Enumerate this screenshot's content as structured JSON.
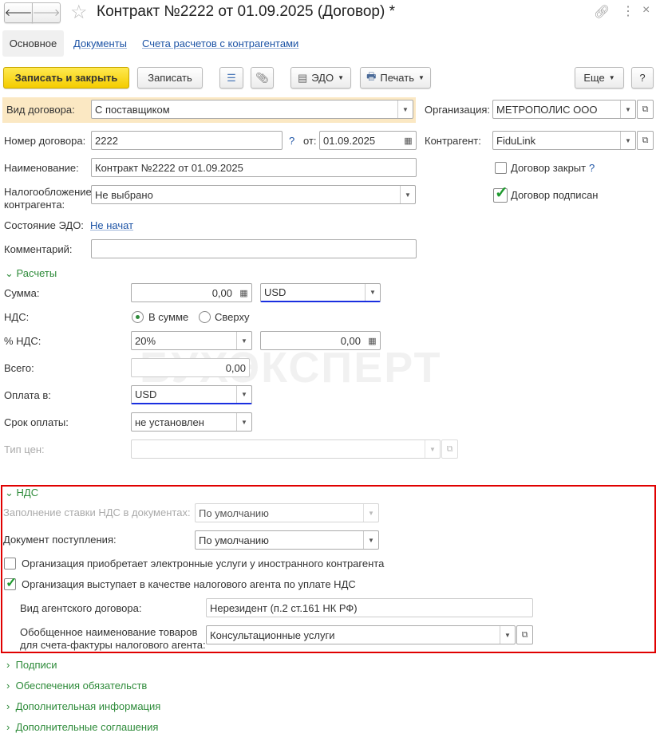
{
  "window": {
    "title": "Контракт №2222 от 01.09.2025 (Договор) *"
  },
  "tabs": [
    {
      "label": "Основное"
    },
    {
      "label": "Документы"
    },
    {
      "label": "Счета расчетов с контрагентами"
    }
  ],
  "toolbar": {
    "save_close": "Записать и закрыть",
    "save": "Записать",
    "edo": "ЭДО",
    "print": "Печать",
    "more": "Еще",
    "help": "?"
  },
  "watermark": "БУХЭКСПЕРТ",
  "main": {
    "contract_type": {
      "label": "Вид договора:",
      "value": "С поставщиком"
    },
    "organization": {
      "label": "Организация:",
      "value": "МЕТРОПОЛИС ООО"
    },
    "number": {
      "label": "Номер договора:",
      "value": "2222",
      "help": "?",
      "date_label": "от:",
      "date": "01.09.2025"
    },
    "counterparty": {
      "label": "Контрагент:",
      "value": "FiduLink"
    },
    "name": {
      "label": "Наименование:",
      "value": "Контракт №2222 от 01.09.2025"
    },
    "closed": {
      "label": "Договор закрыт",
      "help": "?",
      "checked": false
    },
    "taxation": {
      "label1": "Налогообложение",
      "label2": "контрагента:",
      "value": "Не выбрано"
    },
    "signed": {
      "label": "Договор подписан",
      "checked": true
    },
    "edo_state": {
      "label": "Состояние ЭДО:",
      "value": "Не начат"
    },
    "comment": {
      "label": "Комментарий:",
      "value": ""
    }
  },
  "payments": {
    "title": "Расчеты",
    "sum": {
      "label": "Сумма:",
      "value": "0,00",
      "currency": "USD"
    },
    "vat": {
      "label": "НДС:",
      "option1": "В сумме",
      "option2": "Сверху",
      "selected": "В сумме"
    },
    "vat_rate": {
      "label": "% НДС:",
      "value": "20%",
      "amount": "0,00"
    },
    "total": {
      "label": "Всего:",
      "value": "0,00"
    },
    "pay_in": {
      "label": "Оплата в:",
      "value": "USD"
    },
    "term": {
      "label": "Срок оплаты:",
      "value": "не установлен"
    },
    "price_type": {
      "label": "Тип цен:",
      "value": ""
    }
  },
  "vat_section": {
    "title": "НДС",
    "fill_rate": {
      "label": "Заполнение ставки НДС в документах:",
      "value": "По умолчанию"
    },
    "receipt_doc": {
      "label": "Документ поступления:",
      "value": "По умолчанию"
    },
    "e_services": {
      "label": "Организация приобретает электронные услуги у иностранного контрагента",
      "checked": false
    },
    "tax_agent": {
      "label": "Организация выступает в качестве налогового агента по уплате НДС",
      "checked": true
    },
    "agent_type": {
      "label": "Вид агентского договора:",
      "value": "Нерезидент (п.2 ст.161 НК РФ)"
    },
    "goods_name": {
      "label1": "Обобщенное наименование товаров",
      "label2": "для счета-фактуры налогового агента:",
      "value": "Консультационные услуги"
    }
  },
  "sections": [
    {
      "label": "Подписи"
    },
    {
      "label": "Обеспечения обязательств"
    },
    {
      "label": "Дополнительная информация"
    },
    {
      "label": "Дополнительные соглашения"
    }
  ]
}
